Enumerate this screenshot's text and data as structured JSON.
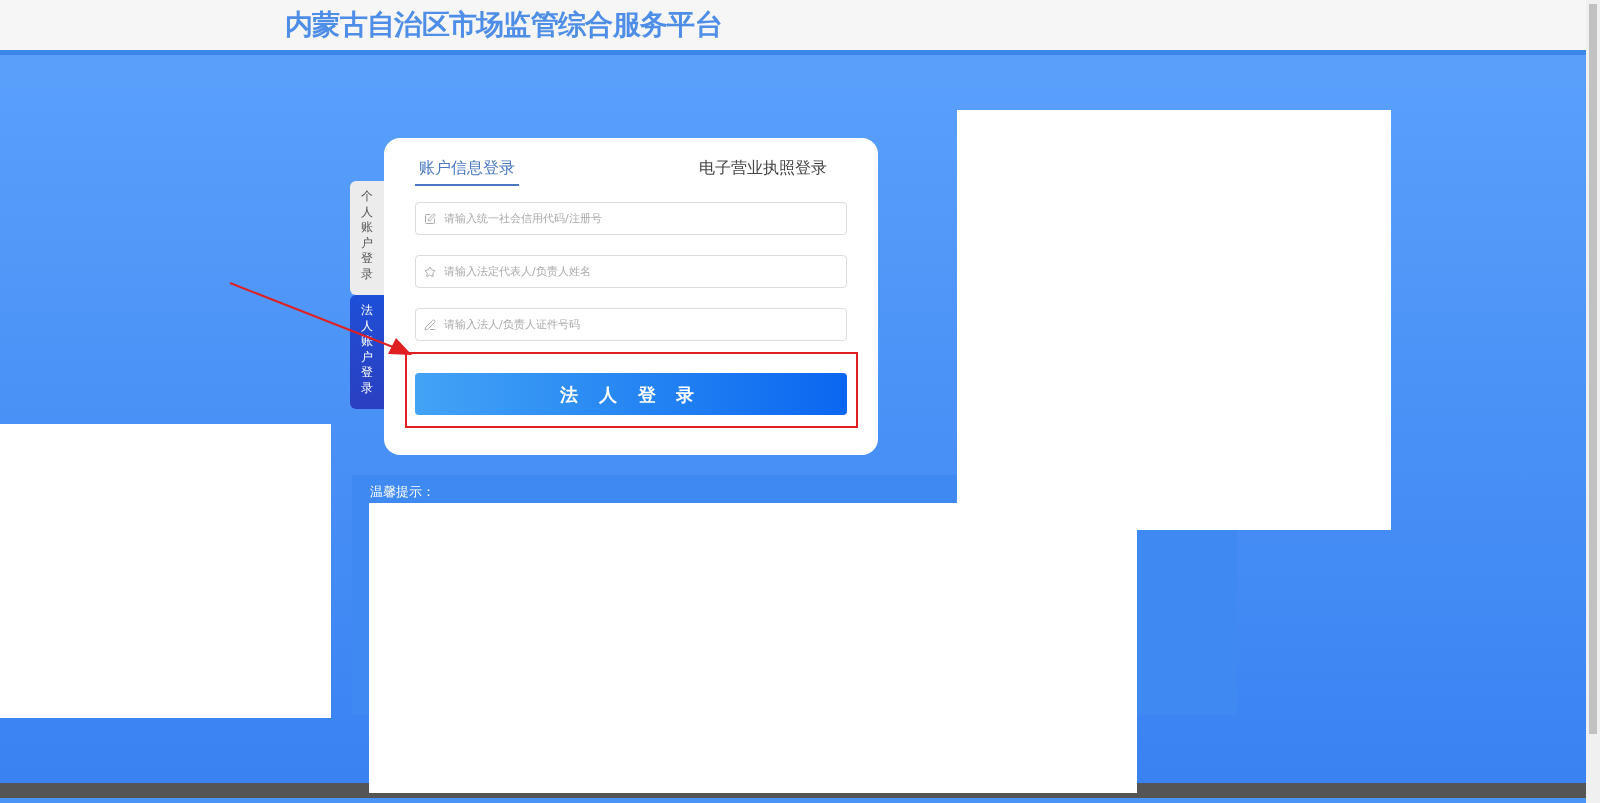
{
  "header": {
    "title": "内蒙古自治区市场监管综合服务平台"
  },
  "side_tabs": [
    {
      "label": "个人账户登录",
      "selected": false
    },
    {
      "label": "法人账户登录",
      "selected": true
    }
  ],
  "login_tabs": [
    {
      "label": "账户信息登录",
      "selected": true
    },
    {
      "label": "电子营业执照登录",
      "selected": false
    }
  ],
  "fields": [
    {
      "placeholder": "请输入统一社会信用代码/注册号"
    },
    {
      "placeholder": "请输入法定代表人/负责人姓名"
    },
    {
      "placeholder": "请输入法人/负责人证件号码"
    }
  ],
  "login_button": {
    "label": "法 人 登 录"
  },
  "notice": {
    "title": "温馨提示："
  }
}
